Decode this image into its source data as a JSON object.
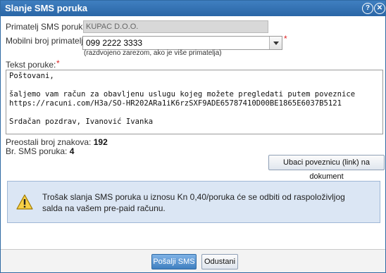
{
  "dialog": {
    "title": "Slanje SMS poruka",
    "help_icon": "help-circle-icon",
    "close_icon": "close-circle-icon"
  },
  "form": {
    "recipient_label": "Primatelj SMS poruke:",
    "recipient_value": "KUPAC D.O.O.",
    "mobile_label": "Mobilni broj primatelja:",
    "mobile_value": "099 2222 3333",
    "required_mark": "*",
    "mobile_hint": "(razdvojeno zarezom, ako je više primatelja)",
    "text_label": "Tekst poruke:",
    "text_value": "Poštovani,\n\nšaljemo vam račun za obavljenu uslugu kojeg možete pregledati putem poveznice\nhttps://racuni.com/H3a/SO-HR202ARa1iK6rzSXF9ADE65787410D00BE1865E6037B5121\n\nSrdačan pozdrav, Ivanović Ivanka"
  },
  "stats": {
    "remaining_label": "Preostali broj znakova:",
    "remaining_value": "192",
    "sms_count_label": "Br. SMS poruka:",
    "sms_count_value": "4"
  },
  "insert_link_button": "Ubaci poveznicu (link) na dokument",
  "warning": {
    "icon": "warning-triangle-icon",
    "text": "Trošak slanja SMS poruka u iznosu Kn 0,40/poruka će se odbiti od raspoloživljog salda na vašem pre-paid računu."
  },
  "footer": {
    "send_button": "Pošalji SMS",
    "cancel_button": "Odustani"
  },
  "colors": {
    "titlebar": "#2f6aa3",
    "warning_bg": "#dbe6f4",
    "required": "#dd2222"
  }
}
